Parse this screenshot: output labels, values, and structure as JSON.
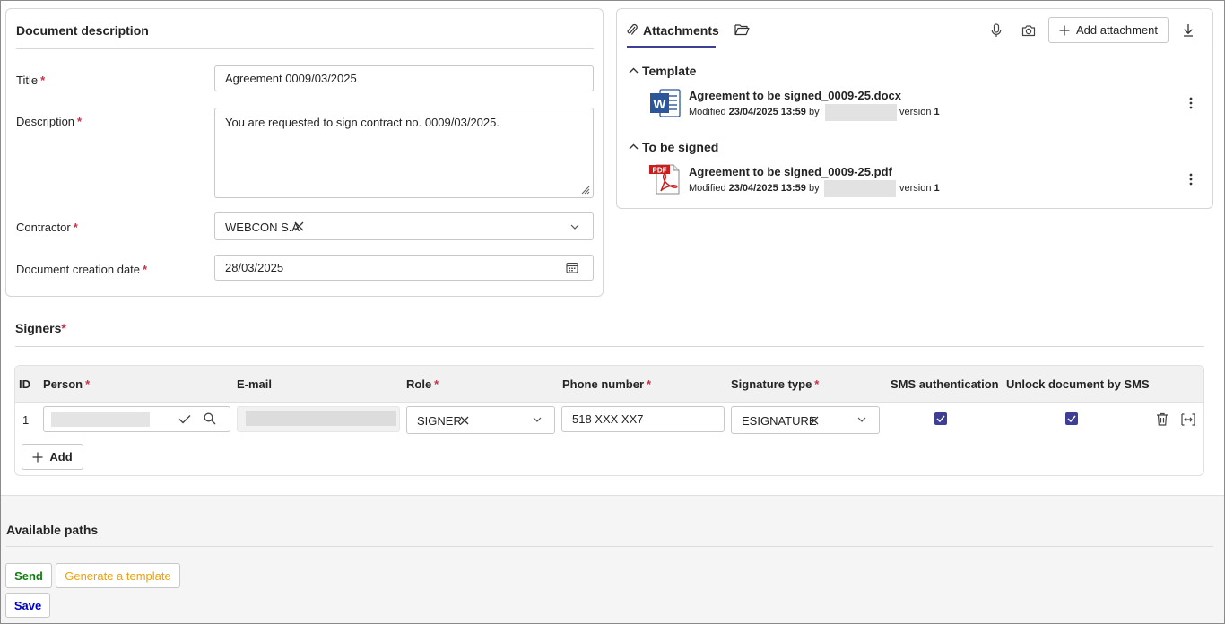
{
  "doc": {
    "section_title": "Document description",
    "title_label": "Title",
    "title_value": "Agreement 0009/03/2025",
    "description_label": "Description",
    "description_value": "You are requested to sign contract no. 0009/03/2025.",
    "contractor_label": "Contractor",
    "contractor_value": "WEBCON S.A",
    "date_label": "Document creation date",
    "date_value": "28/03/2025",
    "required_mark": "*"
  },
  "attachments": {
    "tab_label": "Attachments",
    "add_label": "Add attachment",
    "groups": [
      {
        "name": "Template",
        "file_name": "Agreement to be signed_0009-25.docx",
        "modified_prefix": "Modified",
        "modified_date": "23/04/2025 13:59",
        "by": "by",
        "version_label": "version",
        "version": "1",
        "file_icon": "word-doc-icon"
      },
      {
        "name": "To be signed",
        "file_name": "Agreement to be signed_0009-25.pdf",
        "modified_prefix": "Modified",
        "modified_date": "23/04/2025 13:59",
        "by": "by",
        "version_label": "version",
        "version": "1",
        "file_icon": "pdf-doc-icon"
      }
    ]
  },
  "signers": {
    "section_title": "Signers",
    "columns": [
      "ID",
      "Person",
      "E-mail",
      "Role",
      "Phone number",
      "Signature type",
      "SMS authentication",
      "Unlock document by SMS"
    ],
    "row": {
      "id": "1",
      "role": "SIGNER",
      "phone": "518 XXX XX7",
      "signature_type": "ESIGNATURE",
      "sms_auth": true,
      "unlock_sms": true
    },
    "add_label": "Add"
  },
  "paths": {
    "section_title": "Available paths",
    "send_label": "Send",
    "generate_label": "Generate a template",
    "save_label": "Save"
  },
  "colors": {
    "accent": "#3e3e94",
    "required": "#c4314b",
    "send": "#107c10",
    "generate": "#f2a100",
    "save": "#0000c8"
  }
}
